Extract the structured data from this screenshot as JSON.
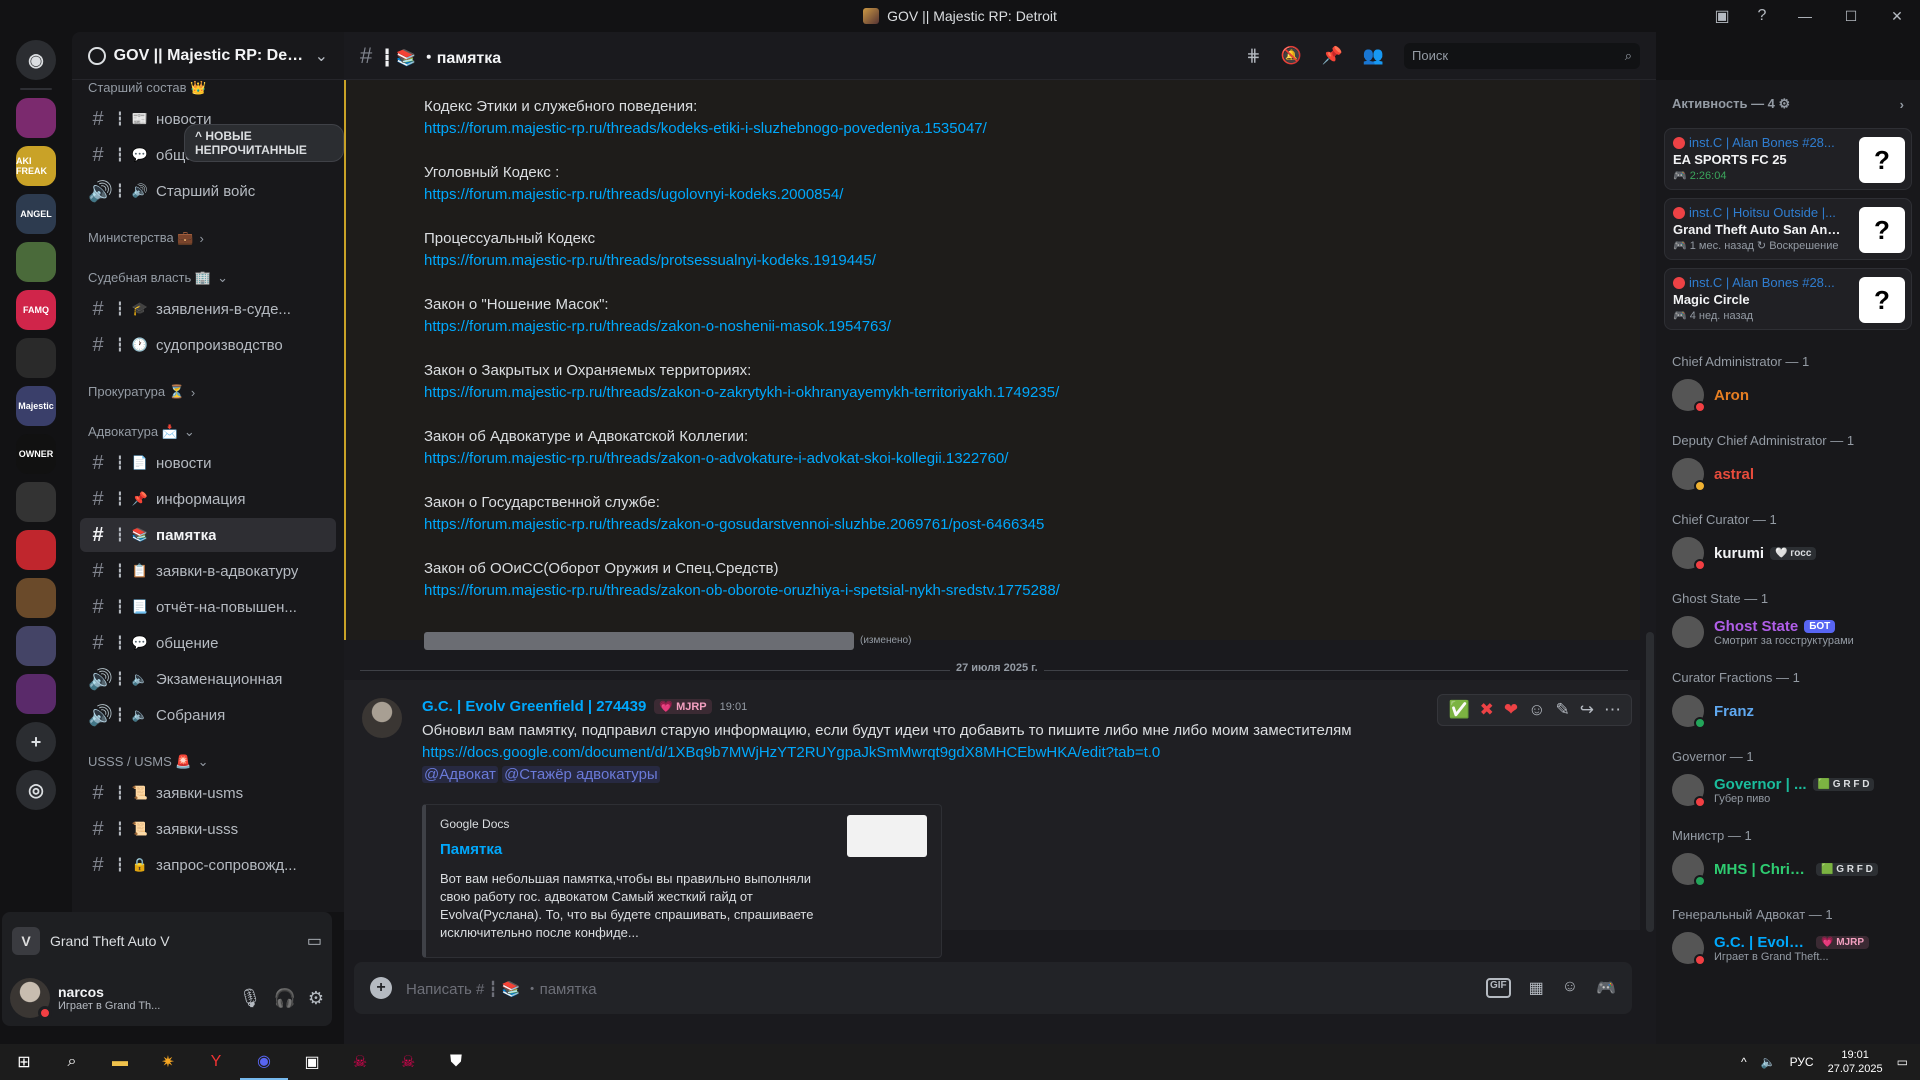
{
  "window": {
    "title": "GOV || Majestic RP: Detroit"
  },
  "rail": {
    "servers": [
      {
        "label": "",
        "color": "#7b2a6e"
      },
      {
        "label": "AKI FREAK",
        "color": "#c9a227"
      },
      {
        "label": "ANGEL",
        "color": "#2d3b4f"
      },
      {
        "label": "",
        "color": "#4a6a3a"
      },
      {
        "label": "FAMQ",
        "color": "#d0254a"
      },
      {
        "label": "",
        "color": "#2a2a2a"
      },
      {
        "label": "Majestic",
        "color": "#3a3f6a"
      },
      {
        "label": "OWNER",
        "color": "#111111"
      },
      {
        "label": "",
        "color": "#333333"
      },
      {
        "label": "",
        "color": "#c0262d"
      },
      {
        "label": "",
        "color": "#6a4a2a"
      },
      {
        "label": "",
        "color": "#444466"
      },
      {
        "label": "",
        "color": "#5a2a6a"
      }
    ]
  },
  "guild": {
    "name": "GOV || Majestic RP: Detr..."
  },
  "new_unread_label": "НОВЫЕ НЕПРОЧИТАННЫЕ",
  "sidebar": {
    "top_category": "Старший состав 👑",
    "items": [
      {
        "type": "channel",
        "icon": "📰",
        "label": "новости",
        "kind": "text"
      },
      {
        "type": "channel",
        "icon": "💬",
        "label": "общение",
        "kind": "text"
      },
      {
        "type": "channel",
        "icon": "🔊",
        "label": "Старший войс",
        "kind": "voice"
      },
      {
        "type": "category",
        "label": "Министерства 💼",
        "chev": "›"
      },
      {
        "type": "category",
        "label": "Судебная власть 🏢",
        "chev": "⌄"
      },
      {
        "type": "channel",
        "icon": "🎓",
        "label": "заявления-в-суде...",
        "kind": "text"
      },
      {
        "type": "channel",
        "icon": "🕐",
        "label": "судопроизводство",
        "kind": "text"
      },
      {
        "type": "category",
        "label": "Прокуратура ⏳",
        "chev": "›"
      },
      {
        "type": "category",
        "label": "Адвокатура 📩",
        "chev": "⌄"
      },
      {
        "type": "channel",
        "icon": "📄",
        "label": "новости",
        "kind": "text"
      },
      {
        "type": "channel",
        "icon": "📌",
        "label": "информация",
        "kind": "text"
      },
      {
        "type": "channel",
        "icon": "📚",
        "label": "памятка",
        "kind": "text",
        "active": true
      },
      {
        "type": "channel",
        "icon": "📋",
        "label": "заявки-в-адвокатуру",
        "kind": "text"
      },
      {
        "type": "channel",
        "icon": "📃",
        "label": "отчёт-на-повышен...",
        "kind": "text"
      },
      {
        "type": "channel",
        "icon": "💬",
        "label": "общение",
        "kind": "text"
      },
      {
        "type": "channel",
        "icon": "🔈",
        "label": "Экзаменационная",
        "kind": "voice"
      },
      {
        "type": "channel",
        "icon": "🔈",
        "label": "Собрания",
        "kind": "voice"
      },
      {
        "type": "category",
        "label": "USSS / USMS 🚨",
        "chev": "⌄"
      },
      {
        "type": "channel",
        "icon": "📜",
        "label": "заявки-usms",
        "kind": "text"
      },
      {
        "type": "channel",
        "icon": "📜",
        "label": "заявки-usss",
        "kind": "text"
      },
      {
        "type": "channel",
        "icon": "🔒",
        "label": "запрос-сопровожд...",
        "kind": "text"
      }
    ]
  },
  "activity_panel": {
    "game": "Grand Theft Auto V"
  },
  "user": {
    "name": "narcos",
    "status": "Играет в Grand Th..."
  },
  "channel": {
    "hash": "#",
    "name": "┇ 📚 ・памятка"
  },
  "search": {
    "placeholder": "Поиск"
  },
  "laws": [
    {
      "title": "Кодекс Этики и служебного поведения:",
      "link": "https://forum.majestic-rp.ru/threads/kodeks-etiki-i-sluzhebnogo-povedeniya.1535047/"
    },
    {
      "title": "Уголовный Кодекс  :",
      "link": "https://forum.majestic-rp.ru/threads/ugolovnyi-kodeks.2000854/"
    },
    {
      "title": "Процессуальный Кодекс",
      "link": "https://forum.majestic-rp.ru/threads/protsessualnyi-kodeks.1919445/"
    },
    {
      "title": "Закон о \"Ношение Масок\":",
      "link": " https://forum.majestic-rp.ru/threads/zakon-o-noshenii-masok.1954763/"
    },
    {
      "title": "Закон о Закрытых и Охраняемых территориях:",
      "link": "https://forum.majestic-rp.ru/threads/zakon-o-zakrytykh-i-okhranyayemykh-territoriyakh.1749235/"
    },
    {
      "title": "Закон об Адвокатуре и Адвокатской Коллегии:",
      "link": "https://forum.majestic-rp.ru/threads/zakon-o-advokature-i-advokat-skoi-kollegii.1322760/"
    },
    {
      "title": "Закон о Государственной службе:",
      "link": "https://forum.majestic-rp.ru/threads/zakon-o-gosudarstvennoi-sluzhbe.2069761/post-6466345"
    },
    {
      "title": "Закон об ООиСС(Оборот Оружия и Спец.Средств)",
      "link": "https://forum.majestic-rp.ru/threads/zakon-ob-oborote-oruzhiya-i-spetsial-nykh-sredstv.1775288/"
    }
  ],
  "edited_label": "(изменено)",
  "date_divider": "27 июля 2025 г.",
  "message": {
    "author": "G.C. | Evolv Greenfield | 274439",
    "tag": "💗 MJRP",
    "time": "19:01",
    "text": "Обновил вам памятку, подправил старую информацию, если будут идеи что добавить то пишите либо мне либо моим заместителям",
    "link": "https://docs.google.com/document/d/1XBq9b7MWjHzYT2RUYgpaJkSmMwrqt9gdX8MHCEbwHKA/edit?tab=t.0",
    "mention1": "@Адвокат",
    "mention2": "@Стажёр адвокатуры",
    "embed": {
      "provider": "Google Docs",
      "title": "Памятка",
      "description": "Вот вам небольшая памятка,чтобы вы правильно выполняли свою работу гос. адвокатом Самый жесткий гайд от Evolva(Руслана). То, что вы будете спрашивать, спрашиваете исключительно после конфиде..."
    }
  },
  "composer": {
    "placeholder": "Написать # ┇ 📚 ・памятка"
  },
  "members": {
    "activity_header": "Активность — 4 ⚙",
    "activities": [
      {
        "who": "inst.C | Alan Bones #28...",
        "what": "EA SPORTS FC 25",
        "when": "🎮 2:26:04",
        "live": true
      },
      {
        "who": "inst.C | Hoitsu Outside |...",
        "what": "Grand Theft Auto San Andr...",
        "when": "🎮 1 мес. назад  ↻ Воскрешение",
        "live": false
      },
      {
        "who": "inst.C | Alan Bones #28...",
        "what": "Magic Circle",
        "when": "🎮 4 нед. назад",
        "live": false
      }
    ],
    "groups": [
      {
        "role": "Chief Administrator — 1",
        "name": "Aron",
        "color": "#e67e22",
        "sub": "",
        "badge": "",
        "status": "#f23f43"
      },
      {
        "role": "Deputy Chief Administrator — 1",
        "name": "astral",
        "color": "#e74c3c",
        "sub": "",
        "badge": "",
        "status": "#f0b232"
      },
      {
        "role": "Chief Curator — 1",
        "name": "kurumi",
        "color": "#f2f3f5",
        "sub": "",
        "badge": "🤍 госс",
        "status": "#f23f43"
      },
      {
        "role": "Ghost State — 1",
        "name": "Ghost State",
        "color": "#b05ee8",
        "sub": "Смотрит за госструктурами",
        "badge": "БОТ",
        "status": ""
      },
      {
        "role": "Curator Fractions — 1",
        "name": "Franz",
        "color": "#5fa8f0",
        "sub": "",
        "badge": "",
        "status": "#23a55a"
      },
      {
        "role": "Governor — 1",
        "name": "Governor | ...",
        "color": "#1abc9c",
        "sub": "Губер пиво",
        "badge": "🟩 G R F D",
        "status": "#f23f43"
      },
      {
        "role": "Министр — 1",
        "name": "MHS | Chris...",
        "color": "#2ecc71",
        "sub": "",
        "badge": "🟩 G R F D",
        "status": "#23a55a"
      },
      {
        "role": "Генеральный Адвокат — 1",
        "name": "G.C. | Evolv Gr...",
        "color": "#00a8fc",
        "sub": "Играет в Grand Theft...",
        "badge": "💗 MJRP",
        "status": "#f23f43"
      }
    ]
  },
  "taskbar": {
    "lang": "РУС",
    "time": "19:01",
    "date": "27.07.2025"
  }
}
